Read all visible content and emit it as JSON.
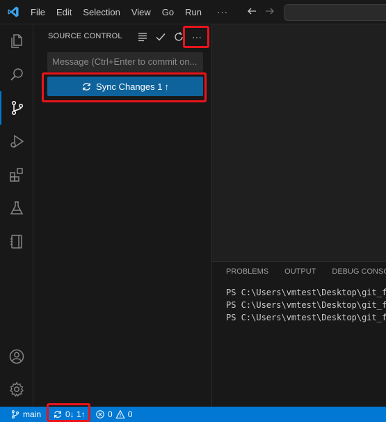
{
  "menu": {
    "items": [
      "File",
      "Edit",
      "Selection",
      "View",
      "Go",
      "Run"
    ],
    "more": "···"
  },
  "activity_bar": {
    "icons": [
      "explorer-icon",
      "search-icon",
      "source-control-icon",
      "run-debug-icon",
      "extensions-icon",
      "testing-icon",
      "notebook-icon"
    ],
    "bottom_icons": [
      "account-icon",
      "settings-gear-icon"
    ]
  },
  "sidebar": {
    "title": "SOURCE CONTROL",
    "actions": [
      "view-as-tree-icon",
      "commit-check-icon",
      "refresh-icon",
      "more-actions-icon"
    ],
    "more_label": "···",
    "message_placeholder": "Message (Ctrl+Enter to commit on...",
    "sync_button": {
      "label": "Sync Changes 1",
      "arrow": "↑"
    }
  },
  "panel": {
    "tabs": [
      "PROBLEMS",
      "OUTPUT",
      "DEBUG CONSOLE"
    ],
    "terminal_lines": [
      "PS C:\\Users\\vmtest\\Desktop\\git_fo",
      "PS C:\\Users\\vmtest\\Desktop\\git_fo",
      "PS C:\\Users\\vmtest\\Desktop\\git_fo"
    ]
  },
  "statusbar": {
    "branch": "main",
    "sync": "0↓ 1↑",
    "errors": "0",
    "warnings": "0"
  },
  "colors": {
    "accent": "#0078d4",
    "button": "#0e639c",
    "highlight": "#e8141c"
  }
}
